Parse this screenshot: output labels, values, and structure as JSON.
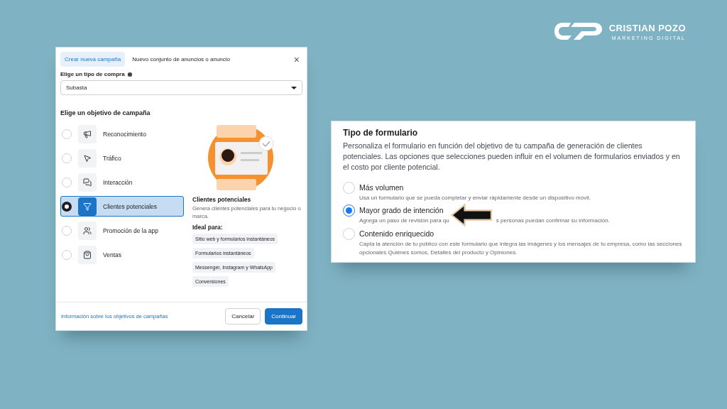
{
  "brand": {
    "name": "CRISTIAN POZO",
    "tagline": "MARKETING DIGITAL"
  },
  "dialog": {
    "tabs": [
      {
        "label": "Crear nueva campaña",
        "selected": true
      },
      {
        "label": "Nuevo conjunto de anuncios o anuncio",
        "selected": false
      }
    ],
    "close": "×",
    "buy_type": {
      "label": "Elige un tipo de compra",
      "value": "Subasta"
    },
    "objective_title": "Elige un objetivo de campaña",
    "objectives": [
      {
        "label": "Reconocimiento",
        "selected": false
      },
      {
        "label": "Tráfico",
        "selected": false
      },
      {
        "label": "Interacción",
        "selected": false
      },
      {
        "label": "Clientes potenciales",
        "selected": true
      },
      {
        "label": "Promoción de la app",
        "selected": false
      },
      {
        "label": "Ventas",
        "selected": false
      }
    ],
    "detail": {
      "title": "Clientes potenciales",
      "description": "Genera clientes potenciales para tu negocio o marca.",
      "ideal_label": "Ideal para:",
      "chips": [
        "Sitio web y formularios instantáneos",
        "Formularios instantáneos",
        "Messenger, Instagram y WhatsApp",
        "Conversiones"
      ]
    },
    "footer": {
      "link": "Información sobre los objetivos de campañas",
      "buttons": [
        {
          "label": "Cancelar",
          "kind": "secondary"
        },
        {
          "label": "Continuar",
          "kind": "primary"
        }
      ]
    }
  },
  "form_type": {
    "title": "Tipo de formulario",
    "description": "Personaliza el formulario en función del objetivo de tu campaña de generación de clientes potenciales. Las opciones que selecciones pueden influir en el volumen de formularios enviados y en el costo por cliente potencial.",
    "options": [
      {
        "label": "Más volumen",
        "description": "Usa un formulario que se pueda completar y enviar rápidamente desde un dispositivo móvil.",
        "selected": false
      },
      {
        "label": "Mayor grado de intención",
        "description": "Agrega un paso de revisión para qu",
        "description_after": "s personas puedan confirmar su información.",
        "selected": true,
        "arrow": true
      },
      {
        "label": "Contenido enriquecido",
        "description": "Capta la atención de tu público con este formulario que integra las imágenes y los mensajes de tu empresa, como las secciones opcionales Quiénes somos, Detalles del producto y Opiniones.",
        "selected": false
      }
    ]
  }
}
